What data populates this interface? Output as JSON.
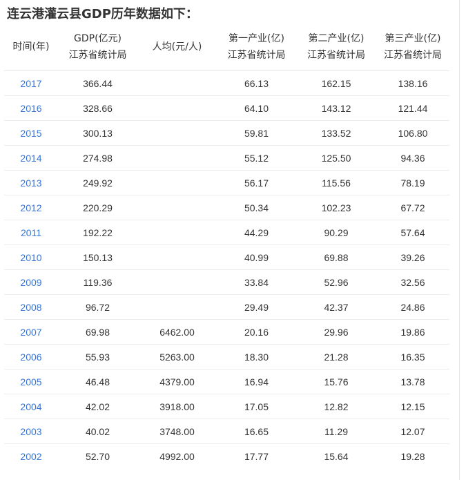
{
  "page": {
    "title": "连云港灌云县GDP历年数据如下："
  },
  "colors": {
    "year_link": "#3576d8",
    "text": "#333333",
    "row_divider": "#ececec"
  },
  "table": {
    "headers": [
      {
        "line1": "时间(年)",
        "line2": ""
      },
      {
        "line1": "GDP(亿元)",
        "line2": "江苏省统计局"
      },
      {
        "line1": "人均(元/人)",
        "line2": ""
      },
      {
        "line1": "第一产业(亿)",
        "line2": "江苏省统计局"
      },
      {
        "line1": "第二产业(亿)",
        "line2": "江苏省统计局"
      },
      {
        "line1": "第三产业(亿)",
        "line2": "江苏省统计局"
      }
    ],
    "rows": [
      {
        "year": "2017",
        "gdp": "366.44",
        "per_capita": "",
        "primary": "66.13",
        "secondary": "162.15",
        "tertiary": "138.16"
      },
      {
        "year": "2016",
        "gdp": "328.66",
        "per_capita": "",
        "primary": "64.10",
        "secondary": "143.12",
        "tertiary": "121.44"
      },
      {
        "year": "2015",
        "gdp": "300.13",
        "per_capita": "",
        "primary": "59.81",
        "secondary": "133.52",
        "tertiary": "106.80"
      },
      {
        "year": "2014",
        "gdp": "274.98",
        "per_capita": "",
        "primary": "55.12",
        "secondary": "125.50",
        "tertiary": "94.36"
      },
      {
        "year": "2013",
        "gdp": "249.92",
        "per_capita": "",
        "primary": "56.17",
        "secondary": "115.56",
        "tertiary": "78.19"
      },
      {
        "year": "2012",
        "gdp": "220.29",
        "per_capita": "",
        "primary": "50.34",
        "secondary": "102.23",
        "tertiary": "67.72"
      },
      {
        "year": "2011",
        "gdp": "192.22",
        "per_capita": "",
        "primary": "44.29",
        "secondary": "90.29",
        "tertiary": "57.64"
      },
      {
        "year": "2010",
        "gdp": "150.13",
        "per_capita": "",
        "primary": "40.99",
        "secondary": "69.88",
        "tertiary": "39.26"
      },
      {
        "year": "2009",
        "gdp": "119.36",
        "per_capita": "",
        "primary": "33.84",
        "secondary": "52.96",
        "tertiary": "32.56"
      },
      {
        "year": "2008",
        "gdp": "96.72",
        "per_capita": "",
        "primary": "29.49",
        "secondary": "42.37",
        "tertiary": "24.86"
      },
      {
        "year": "2007",
        "gdp": "69.98",
        "per_capita": "6462.00",
        "primary": "20.16",
        "secondary": "29.96",
        "tertiary": "19.86"
      },
      {
        "year": "2006",
        "gdp": "55.93",
        "per_capita": "5263.00",
        "primary": "18.30",
        "secondary": "21.28",
        "tertiary": "16.35"
      },
      {
        "year": "2005",
        "gdp": "46.48",
        "per_capita": "4379.00",
        "primary": "16.94",
        "secondary": "15.76",
        "tertiary": "13.78"
      },
      {
        "year": "2004",
        "gdp": "42.02",
        "per_capita": "3918.00",
        "primary": "17.05",
        "secondary": "12.82",
        "tertiary": "12.15"
      },
      {
        "year": "2003",
        "gdp": "40.02",
        "per_capita": "3748.00",
        "primary": "16.65",
        "secondary": "11.29",
        "tertiary": "12.07"
      },
      {
        "year": "2002",
        "gdp": "52.70",
        "per_capita": "4992.00",
        "primary": "17.77",
        "secondary": "15.64",
        "tertiary": "19.28"
      }
    ]
  }
}
